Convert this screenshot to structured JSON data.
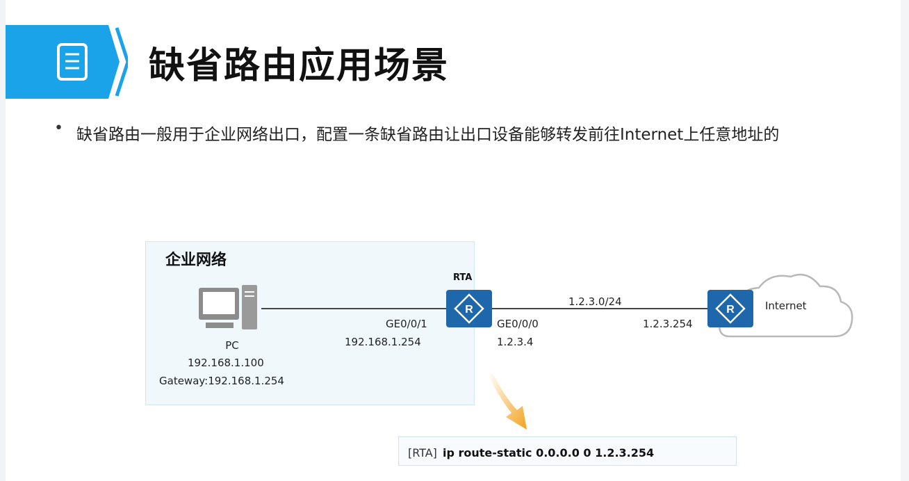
{
  "header": {
    "title": "缺省路由应用场景"
  },
  "intro": {
    "bullet": "•",
    "text": "缺省路由一般用于企业网络出口，配置一条缺省路由让出口设备能够转发前往Internet上任意地址的"
  },
  "diagram": {
    "zone_label": "企业网络",
    "pc": {
      "name": "PC",
      "ip": "192.168.1.100",
      "gateway": "Gateway:192.168.1.254"
    },
    "rta": {
      "name": "RTA",
      "left_if": "GE0/0/1",
      "left_ip": "192.168.1.254",
      "right_if": "GE0/0/0",
      "right_ip": "1.2.3.4"
    },
    "wan_subnet": "1.2.3.0/24",
    "isp_ip": "1.2.3.254",
    "cloud_label": "Internet",
    "icons": [
      "document-icon",
      "chevron-right-icon",
      "pc-icon",
      "router-icon",
      "cloud-icon",
      "arrow-down-icon"
    ]
  },
  "command": {
    "prefix": "[RTA]",
    "text": "ip route-static 0.0.0.0 0 1.2.3.254"
  },
  "colors": {
    "accent": "#1aa3e8",
    "router": "#1e67ab",
    "zone_bg": "#f0f8fc",
    "arrow": "#f3a21d"
  }
}
